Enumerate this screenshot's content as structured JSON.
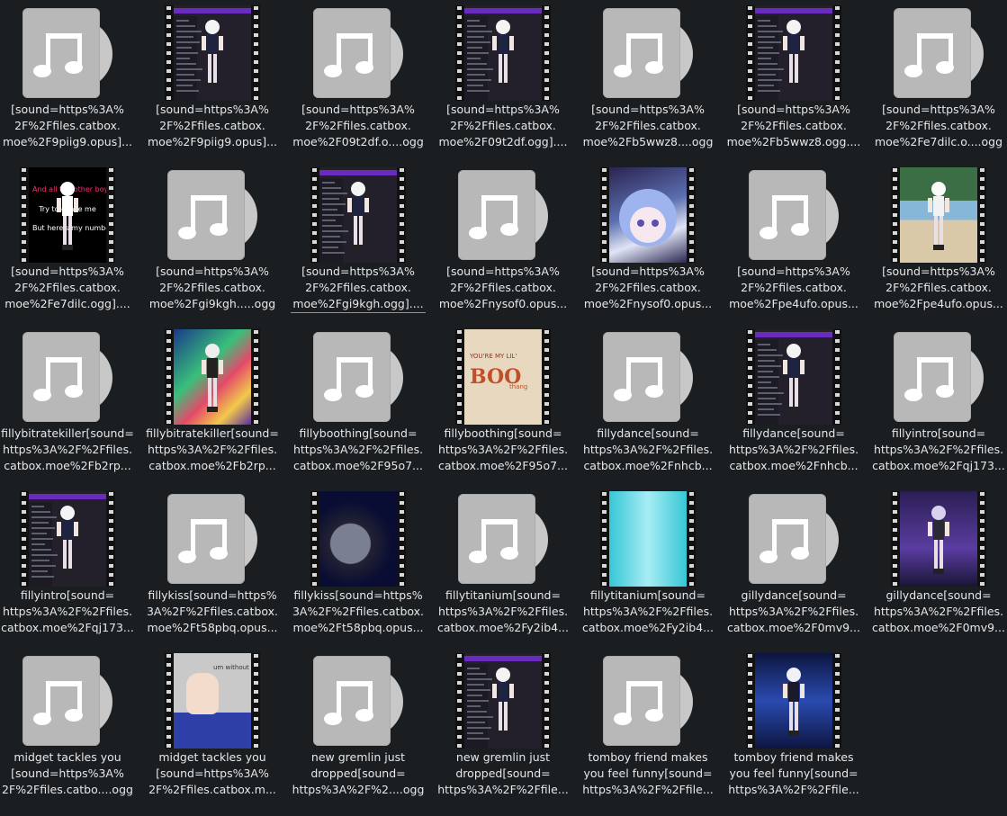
{
  "files": [
    {
      "type": "audio",
      "lines": [
        "[sound=https%3A%",
        "2F%2Ffiles.catbox.",
        "moe%2F9piig9.opus]..."
      ]
    },
    {
      "type": "video",
      "style": "ui",
      "lines": [
        "[sound=https%3A%",
        "2F%2Ffiles.catbox.",
        "moe%2F9piig9.opus]..."
      ]
    },
    {
      "type": "audio",
      "lines": [
        "[sound=https%3A%",
        "2F%2Ffiles.catbox.",
        "moe%2F09t2df.o....ogg"
      ]
    },
    {
      "type": "video",
      "style": "ui",
      "lines": [
        "[sound=https%3A%",
        "2F%2Ffiles.catbox.",
        "moe%2F09t2df.ogg]...."
      ]
    },
    {
      "type": "audio",
      "lines": [
        "[sound=https%3A%",
        "2F%2Ffiles.catbox.",
        "moe%2Fb5wwz8....ogg"
      ]
    },
    {
      "type": "video",
      "style": "ui",
      "lines": [
        "[sound=https%3A%",
        "2F%2Ffiles.catbox.",
        "moe%2Fb5wwz8.ogg...."
      ]
    },
    {
      "type": "audio",
      "lines": [
        "[sound=https%3A%",
        "2F%2Ffiles.catbox.",
        "moe%2Fe7dilc.o....ogg"
      ]
    },
    {
      "type": "video",
      "style": "lyrics",
      "caption": [
        "And all the other boy",
        "Try to chase me",
        "But here's my numbe"
      ],
      "lines": [
        "[sound=https%3A%",
        "2F%2Ffiles.catbox.",
        "moe%2Fe7dilc.ogg]...."
      ]
    },
    {
      "type": "audio",
      "lines": [
        "[sound=https%3A%",
        "2F%2Ffiles.catbox.",
        "moe%2Fgi9kgh.....ogg"
      ]
    },
    {
      "type": "video",
      "style": "ui",
      "selected": true,
      "lines": [
        "[sound=https%3A%",
        "2F%2Ffiles.catbox.",
        "moe%2Fgi9kgh.ogg]...."
      ]
    },
    {
      "type": "audio",
      "lines": [
        "[sound=https%3A%",
        "2F%2Ffiles.catbox.",
        "moe%2Fnysof0.opus..."
      ]
    },
    {
      "type": "video",
      "style": "anime",
      "lines": [
        "[sound=https%3A%",
        "2F%2Ffiles.catbox.",
        "moe%2Fnysof0.opus..."
      ]
    },
    {
      "type": "audio",
      "lines": [
        "[sound=https%3A%",
        "2F%2Ffiles.catbox.",
        "moe%2Fpe4ufo.opus..."
      ]
    },
    {
      "type": "video",
      "style": "beach",
      "lines": [
        "[sound=https%3A%",
        "2F%2Ffiles.catbox.",
        "moe%2Fpe4ufo.opus..."
      ]
    },
    {
      "type": "audio",
      "lines": [
        "fillybitratekiller[sound=",
        "https%3A%2F%2Ffiles.",
        "catbox.moe%2Fb2rp..."
      ]
    },
    {
      "type": "video",
      "style": "disco",
      "lines": [
        "fillybitratekiller[sound=",
        "https%3A%2F%2Ffiles.",
        "catbox.moe%2Fb2rp..."
      ]
    },
    {
      "type": "audio",
      "lines": [
        "fillyboothing[sound=",
        "https%3A%2F%2Ffiles.",
        "catbox.moe%2F95o7..."
      ]
    },
    {
      "type": "video",
      "style": "boo",
      "boo_small": "YOU'RE MY LIL'",
      "boo_big": "BOO",
      "boo_tail": "thang",
      "lines": [
        "fillyboothing[sound=",
        "https%3A%2F%2Ffiles.",
        "catbox.moe%2F95o7..."
      ]
    },
    {
      "type": "audio",
      "lines": [
        "fillydance[sound=",
        "https%3A%2F%2Ffiles.",
        "catbox.moe%2Fnhcb..."
      ]
    },
    {
      "type": "video",
      "style": "ui",
      "lines": [
        "fillydance[sound=",
        "https%3A%2F%2Ffiles.",
        "catbox.moe%2Fnhcb..."
      ]
    },
    {
      "type": "audio",
      "lines": [
        "fillyintro[sound=",
        "https%3A%2F%2Ffiles.",
        "catbox.moe%2Fqj173..."
      ]
    },
    {
      "type": "video",
      "style": "ui",
      "lines": [
        "fillyintro[sound=",
        "https%3A%2F%2Ffiles.",
        "catbox.moe%2Fqj173..."
      ]
    },
    {
      "type": "audio",
      "lines": [
        "fillykiss[sound=https%",
        "3A%2F%2Ffiles.catbox.",
        "moe%2Ft58pbq.opus..."
      ]
    },
    {
      "type": "video",
      "style": "space",
      "lines": [
        "fillykiss[sound=https%",
        "3A%2F%2Ffiles.catbox.",
        "moe%2Ft58pbq.opus..."
      ]
    },
    {
      "type": "audio",
      "lines": [
        "fillytitanium[sound=",
        "https%3A%2F%2Ffiles.",
        "catbox.moe%2Fy2ib4..."
      ]
    },
    {
      "type": "video",
      "style": "cyan",
      "lines": [
        "fillytitanium[sound=",
        "https%3A%2F%2Ffiles.",
        "catbox.moe%2Fy2ib4..."
      ]
    },
    {
      "type": "audio",
      "lines": [
        "gillydance[sound=",
        "https%3A%2F%2Ffiles.",
        "catbox.moe%2F0mv9..."
      ]
    },
    {
      "type": "video",
      "style": "purple",
      "lines": [
        "gillydance[sound=",
        "https%3A%2F%2Ffiles.",
        "catbox.moe%2F0mv9..."
      ]
    },
    {
      "type": "audio",
      "lines": [
        "midget tackles you",
        "[sound=https%3A%",
        "2F%2Ffiles.catbo....ogg"
      ]
    },
    {
      "type": "video",
      "style": "hand",
      "hand_text": "um without",
      "lines": [
        "midget tackles you",
        "[sound=https%3A%",
        "2F%2Ffiles.catbox.m..."
      ]
    },
    {
      "type": "audio",
      "lines": [
        "new gremlin just",
        "dropped[sound=",
        "https%3A%2F%2....ogg"
      ]
    },
    {
      "type": "video",
      "style": "ui",
      "lines": [
        "new gremlin just",
        "dropped[sound=",
        "https%3A%2F%2Ffile..."
      ]
    },
    {
      "type": "audio",
      "lines": [
        "tomboy friend makes",
        "you feel funny[sound=",
        "https%3A%2F%2Ffile..."
      ]
    },
    {
      "type": "video",
      "style": "blue",
      "lines": [
        "tomboy friend makes",
        "you feel funny[sound=",
        "https%3A%2F%2Ffile..."
      ]
    }
  ]
}
